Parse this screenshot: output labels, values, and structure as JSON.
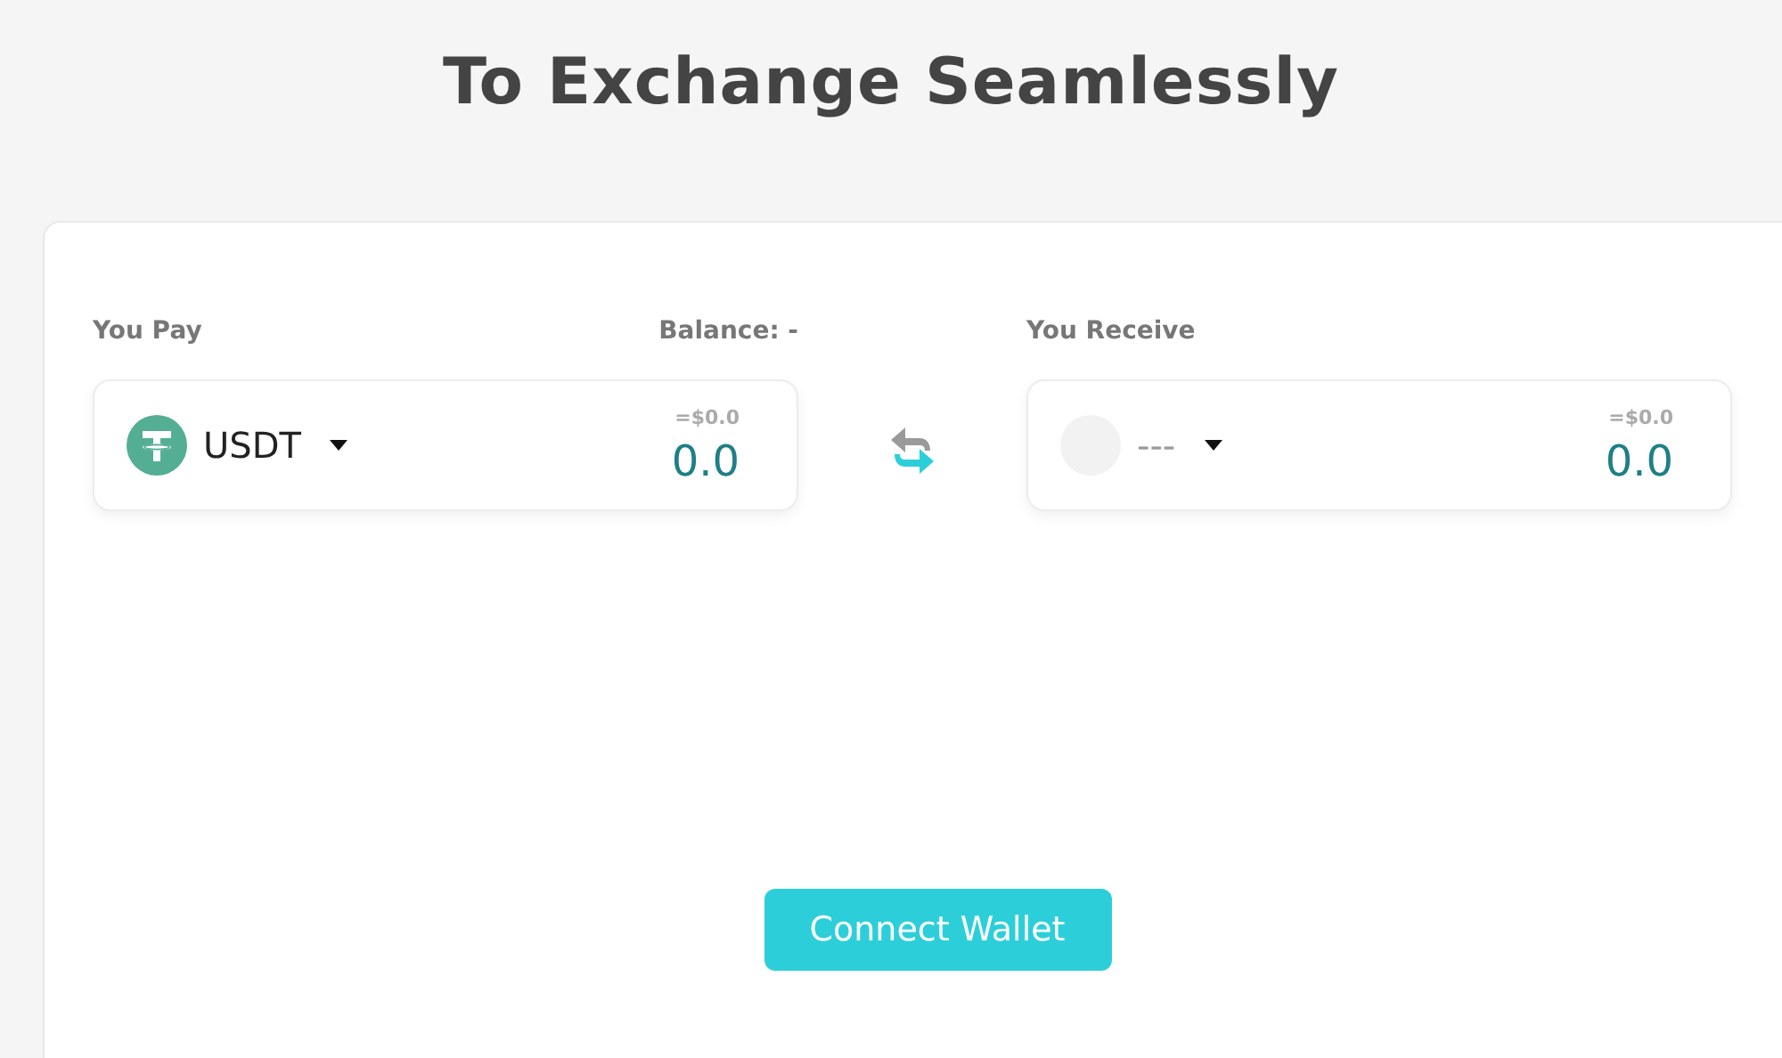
{
  "title": "To Exchange Seamlessly",
  "pay": {
    "label": "You Pay",
    "balance": "Balance: -",
    "token": {
      "kind": "tether",
      "symbol": "USDT"
    },
    "usd_value": "=$0.0",
    "amount": "0.0"
  },
  "receive": {
    "label": "You Receive",
    "token": {
      "kind": "empty",
      "symbol": "---"
    },
    "usd_value": "=$0.0",
    "amount": "0.0"
  },
  "button": "Connect Wallet"
}
